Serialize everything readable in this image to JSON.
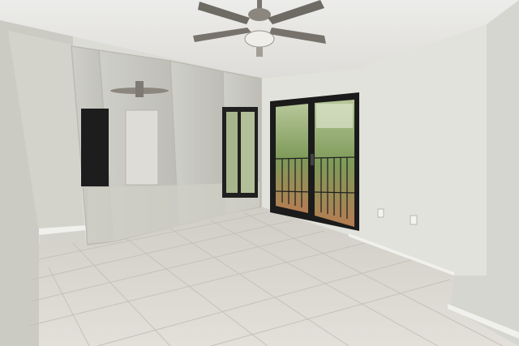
{
  "scene": {
    "kind": "photo",
    "subject": "empty bedroom",
    "elements": [
      "ceiling-fan",
      "mirrored-closet-doors",
      "sliding-glass-door",
      "balcony-railing",
      "tile-floor",
      "electrical-outlet"
    ],
    "colors": {
      "ceiling": "#e9e9e5",
      "wall_left": "#cfcfc8",
      "wall_back": "#e4e4de",
      "wall_right": "#d8d8d2",
      "floor": "#d9d7cf",
      "door_frame": "#1b1b1b",
      "glass_greenery": "#6f8f4e",
      "mirror": "#c8c8c2",
      "fan_metal": "#6e6a64"
    }
  }
}
